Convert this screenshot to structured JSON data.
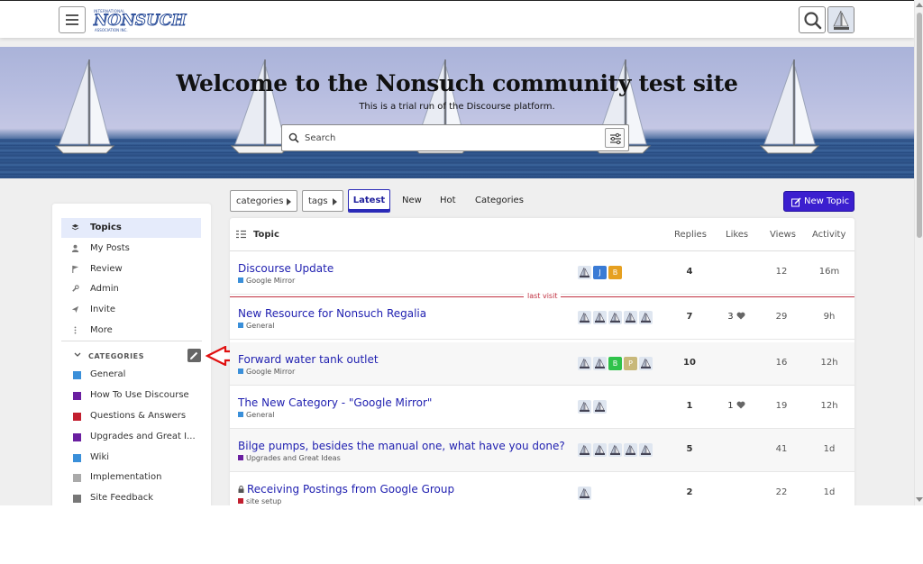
{
  "header": {
    "logo_top": "INTERNATIONAL",
    "logo_name": "NONSUCH",
    "logo_bottom": "ASSOCIATION INC."
  },
  "banner": {
    "title": "Welcome to the Nonsuch community test site",
    "subtitle": "This is a trial run of the Discourse platform.",
    "search_placeholder": "Search"
  },
  "sidebar": {
    "items": [
      {
        "label": "Topics",
        "icon": "layers-icon"
      },
      {
        "label": "My Posts",
        "icon": "user-icon"
      },
      {
        "label": "Review",
        "icon": "flag-icon"
      },
      {
        "label": "Admin",
        "icon": "wrench-icon"
      },
      {
        "label": "Invite",
        "icon": "paper-plane-icon"
      },
      {
        "label": "More",
        "icon": "ellipsis-vertical-icon"
      }
    ],
    "categories_header": "CATEGORIES",
    "categories": [
      {
        "label": "General",
        "color": "#3a8fd9"
      },
      {
        "label": "How To Use Discourse",
        "color": "#6a1fa0"
      },
      {
        "label": "Questions & Answers",
        "color": "#c21f2f"
      },
      {
        "label": "Upgrades and Great I...",
        "color": "#6a1fa0"
      },
      {
        "label": "Wiki",
        "color": "#3a8fd9"
      },
      {
        "label": "Implementation",
        "color": "#aaaaaa"
      },
      {
        "label": "Site Feedback",
        "color": "#777777"
      }
    ]
  },
  "nav": {
    "categories_label": "categories",
    "tags_label": "tags",
    "tabs": [
      "Latest",
      "New",
      "Hot",
      "Categories"
    ],
    "new_topic_label": "New Topic"
  },
  "table": {
    "headers": {
      "topic": "Topic",
      "replies": "Replies",
      "likes": "Likes",
      "views": "Views",
      "activity": "Activity"
    },
    "last_visit_label": "last visit",
    "rows": [
      {
        "title": "Discourse Update",
        "category": "Google Mirror",
        "category_color": "#3a8fd9",
        "replies": "4",
        "likes": "",
        "views": "12",
        "activity": "16m",
        "locked": false
      },
      {
        "title": "New Resource for Nonsuch Regalia",
        "category": "General",
        "category_color": "#3a8fd9",
        "replies": "7",
        "likes": "3",
        "views": "29",
        "activity": "9h",
        "locked": false
      },
      {
        "title": "Forward water tank outlet",
        "category": "Google Mirror",
        "category_color": "#3a8fd9",
        "replies": "10",
        "likes": "",
        "views": "16",
        "activity": "12h",
        "locked": false
      },
      {
        "title": "The New Category - \"Google Mirror\"",
        "category": "General",
        "category_color": "#3a8fd9",
        "replies": "1",
        "likes": "1",
        "views": "19",
        "activity": "12h",
        "locked": false
      },
      {
        "title": "Bilge pumps, besides the manual one, what have you done?",
        "category": "Upgrades and Great Ideas",
        "category_color": "#6a1fa0",
        "replies": "5",
        "likes": "",
        "views": "41",
        "activity": "1d",
        "locked": false
      },
      {
        "title": "Receiving Postings from Google Group",
        "category": "site setup",
        "category_color": "#c21f2f",
        "replies": "2",
        "likes": "",
        "views": "22",
        "activity": "1d",
        "locked": true
      }
    ],
    "poster_letters": {
      "j": "J",
      "b": "B",
      "p": "P"
    }
  },
  "colors": {
    "accent": "#3b1fcf",
    "link": "#1f1fb0",
    "last_visit": "#c03040",
    "annotation_arrow": "#e01010"
  }
}
